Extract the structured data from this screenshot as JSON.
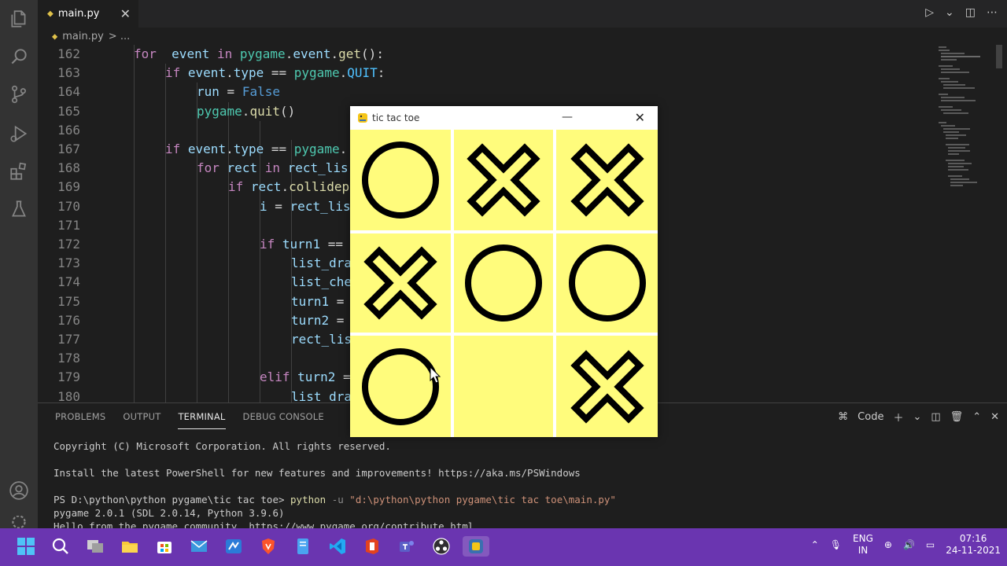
{
  "editor": {
    "tab_label": "main.py",
    "breadcrumb_file": "main.py",
    "breadcrumb_sep": "> ...",
    "lines": [
      {
        "n": "162",
        "indent": 1,
        "tokens": [
          [
            "k",
            "for"
          ],
          [
            "",
            "  "
          ],
          [
            "v",
            "event"
          ],
          [
            "",
            " "
          ],
          [
            "k",
            "in"
          ],
          [
            "",
            " "
          ],
          [
            "m",
            "pygame"
          ],
          [
            "",
            "."
          ],
          [
            "v",
            "event"
          ],
          [
            "",
            "."
          ],
          [
            "f",
            "get"
          ],
          [
            "",
            "():"
          ]
        ]
      },
      {
        "n": "163",
        "indent": 2,
        "tokens": [
          [
            "k",
            "if"
          ],
          [
            "",
            " "
          ],
          [
            "v",
            "event"
          ],
          [
            "",
            "."
          ],
          [
            "v",
            "type"
          ],
          [
            "",
            " == "
          ],
          [
            "m",
            "pygame"
          ],
          [
            "",
            "."
          ],
          [
            "c",
            "QUIT"
          ],
          [
            "",
            ":"
          ]
        ]
      },
      {
        "n": "164",
        "indent": 3,
        "tokens": [
          [
            "v",
            "run"
          ],
          [
            "",
            " = "
          ],
          [
            "kb",
            "False"
          ]
        ]
      },
      {
        "n": "165",
        "indent": 3,
        "tokens": [
          [
            "m",
            "pygame"
          ],
          [
            "",
            "."
          ],
          [
            "f",
            "quit"
          ],
          [
            "",
            "()"
          ]
        ]
      },
      {
        "n": "166",
        "indent": 0,
        "tokens": []
      },
      {
        "n": "167",
        "indent": 2,
        "tokens": [
          [
            "k",
            "if"
          ],
          [
            "",
            " "
          ],
          [
            "v",
            "event"
          ],
          [
            "",
            "."
          ],
          [
            "v",
            "type"
          ],
          [
            "",
            " == "
          ],
          [
            "m",
            "pygame"
          ],
          [
            "",
            "."
          ]
        ]
      },
      {
        "n": "168",
        "indent": 3,
        "tokens": [
          [
            "k",
            "for"
          ],
          [
            "",
            " "
          ],
          [
            "v",
            "rect"
          ],
          [
            "",
            " "
          ],
          [
            "k",
            "in"
          ],
          [
            "",
            " "
          ],
          [
            "v",
            "rect_lis"
          ]
        ]
      },
      {
        "n": "169",
        "indent": 4,
        "tokens": [
          [
            "k",
            "if"
          ],
          [
            "",
            " "
          ],
          [
            "v",
            "rect"
          ],
          [
            "",
            "."
          ],
          [
            "f",
            "collidep"
          ]
        ]
      },
      {
        "n": "170",
        "indent": 5,
        "tokens": [
          [
            "v",
            "i"
          ],
          [
            "",
            " = "
          ],
          [
            "v",
            "rect_lis"
          ]
        ]
      },
      {
        "n": "171",
        "indent": 0,
        "tokens": []
      },
      {
        "n": "172",
        "indent": 5,
        "tokens": [
          [
            "k",
            "if"
          ],
          [
            "",
            " "
          ],
          [
            "v",
            "turn1"
          ],
          [
            "",
            " =="
          ]
        ]
      },
      {
        "n": "173",
        "indent": 6,
        "tokens": [
          [
            "v",
            "list_dra"
          ]
        ]
      },
      {
        "n": "174",
        "indent": 6,
        "tokens": [
          [
            "v",
            "list_che"
          ]
        ]
      },
      {
        "n": "175",
        "indent": 6,
        "tokens": [
          [
            "v",
            "turn1"
          ],
          [
            "",
            " ="
          ]
        ]
      },
      {
        "n": "176",
        "indent": 6,
        "tokens": [
          [
            "v",
            "turn2"
          ],
          [
            "",
            " ="
          ]
        ]
      },
      {
        "n": "177",
        "indent": 6,
        "tokens": [
          [
            "v",
            "rect_lis"
          ]
        ]
      },
      {
        "n": "178",
        "indent": 0,
        "tokens": []
      },
      {
        "n": "179",
        "indent": 5,
        "tokens": [
          [
            "k",
            "elif"
          ],
          [
            "",
            " "
          ],
          [
            "v",
            "turn2"
          ],
          [
            "",
            " ="
          ]
        ]
      },
      {
        "n": "180",
        "indent": 6,
        "tokens": [
          [
            "v",
            "list_dra"
          ]
        ]
      }
    ]
  },
  "panel": {
    "tabs": [
      "PROBLEMS",
      "OUTPUT",
      "TERMINAL",
      "DEBUG CONSOLE"
    ],
    "active_tab": "TERMINAL",
    "shell_label": "Code",
    "terminal": {
      "l1": "Copyright (C) Microsoft Corporation. All rights reserved.",
      "l2": "Install the latest PowerShell for new features and improvements! https://aka.ms/PSWindows",
      "prompt": "PS D:\\python\\python pygame\\tic tac toe> ",
      "cmd": "python",
      "flag": " -u ",
      "path": "\"d:\\python\\python pygame\\tic tac toe\\main.py\"",
      "l4": "pygame 2.0.1 (SDL 2.0.14, Python 3.9.6)",
      "l5": "Hello from the pygame community. https://www.pygame.org/contribute.html"
    }
  },
  "game": {
    "title": "tic tac toe",
    "cell_color": "#fffc7c",
    "board": [
      "O",
      "X",
      "X",
      "X",
      "O",
      "O",
      "O",
      "",
      "X"
    ]
  },
  "taskbar": {
    "lang_top": "ENG",
    "lang_bottom": "IN",
    "time": "07:16",
    "date": "24-11-2021",
    "color": "#6a35b0"
  }
}
